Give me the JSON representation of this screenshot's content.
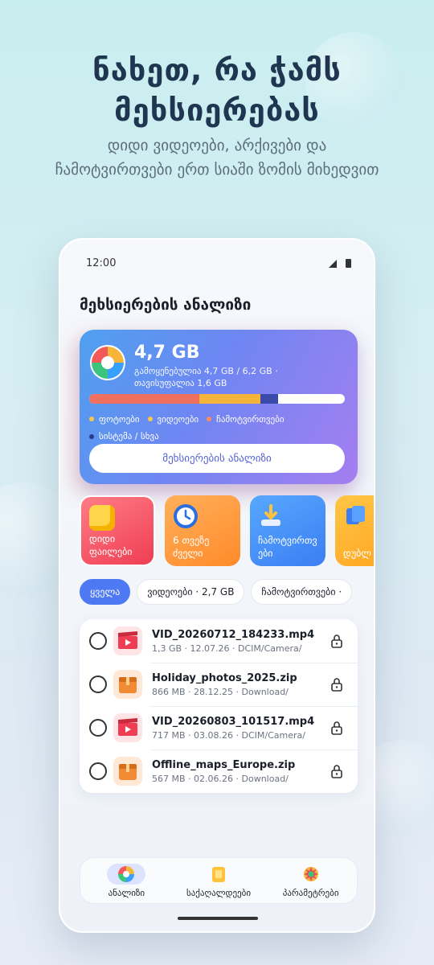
{
  "hero": {
    "title_line1": "ნახეთ, რა ჭამს",
    "title_line2": "მეხსიერებას",
    "subtitle": "დიდი ვიდეოები, არქივები და ჩამოტვირთვები ერთ სიაში ზომის მიხედვით"
  },
  "status": {
    "time": "12:00"
  },
  "screen_title": "მეხსიერების ანალიზი",
  "storage": {
    "size": "4,7 GB",
    "used_line": "გამოყენებულია 4,7 GB / 6,2 GB ·",
    "free_line": "თავისუფალია 1,6 GB",
    "segments": [
      {
        "name": "ფოტოები",
        "color": "#f07060",
        "fraction": 0.43
      },
      {
        "name": "ვიდეოები",
        "color": "#f6b43a",
        "fraction": 0.24
      },
      {
        "name": "ჩამოტვირთვები",
        "color": "#3b4aa8",
        "fraction": 0.07
      }
    ],
    "legend": [
      {
        "label": "ფოტოები",
        "color": "#f6c94a"
      },
      {
        "label": "ვიდეოები",
        "color": "#f6c94a"
      },
      {
        "label": "ჩამოტვირთვები",
        "color": "#ff8a5c"
      },
      {
        "label": "სისტემა / სხვა",
        "color": "#2b3a8c"
      }
    ],
    "analyze_button": "მეხსიერების ანალიზი"
  },
  "tiles": [
    {
      "label": "დიდი ფაილები",
      "icon": "folder-icon"
    },
    {
      "label": "6 თვეზე ძველი",
      "icon": "clock-icon"
    },
    {
      "label": "ჩამოტვირთვ ები",
      "icon": "download-icon"
    },
    {
      "label": "დუბლ ები",
      "icon": "duplicate-icon"
    }
  ],
  "chips": [
    {
      "label": "ყველა",
      "active": true
    },
    {
      "label": "ვიდეოები · 2,7 GB",
      "active": false
    },
    {
      "label": "ჩამოტვირთვები ·",
      "active": false
    }
  ],
  "files": [
    {
      "name": "VID_20260712_184233.mp4",
      "meta": "1,3 GB · 12.07.26 · DCIM/Camera/",
      "type": "video"
    },
    {
      "name": "Holiday_photos_2025.zip",
      "meta": "866 MB · 28.12.25 · Download/",
      "type": "zip"
    },
    {
      "name": "VID_20260803_101517.mp4",
      "meta": "717 MB · 03.08.26 · DCIM/Camera/",
      "type": "video"
    },
    {
      "name": "Offline_maps_Europe.zip",
      "meta": "567 MB · 02.06.26 · Download/",
      "type": "zip"
    }
  ],
  "nav": [
    {
      "label": "ანალიზი",
      "icon": "pie-chart-icon",
      "active": true
    },
    {
      "label": "საქაღალდეები",
      "icon": "folder-icon",
      "active": false
    },
    {
      "label": "პარამეტრები",
      "icon": "settings-icon",
      "active": false
    }
  ]
}
